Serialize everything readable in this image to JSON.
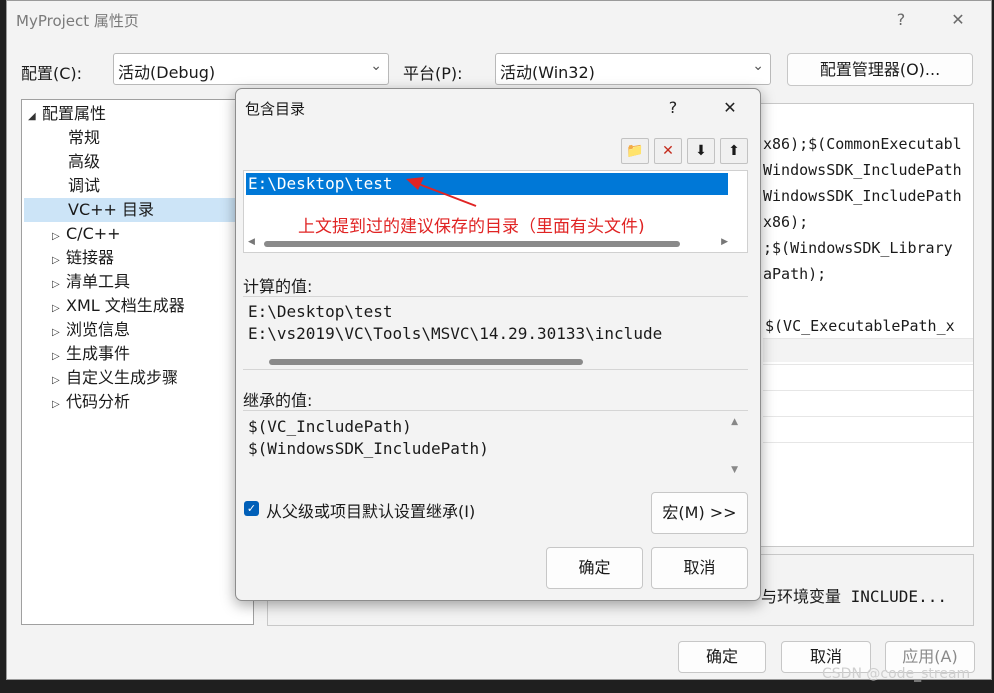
{
  "window": {
    "title": "MyProject 属性页",
    "help": "?",
    "close": "✕"
  },
  "config": {
    "config_label": "配置(C):",
    "config_value": "活动(Debug)",
    "platform_label": "平台(P):",
    "platform_value": "活动(Win32)",
    "manager_button": "配置管理器(O)..."
  },
  "tree": {
    "root": "配置属性",
    "items": [
      "常规",
      "高级",
      "调试",
      "VC++ 目录",
      "C/C++",
      "链接器",
      "清单工具",
      "XML 文档生成器",
      "浏览信息",
      "生成事件",
      "自定义生成步骤",
      "代码分析"
    ],
    "selected": "VC++ 目录"
  },
  "grid": {
    "lines": [
      "x86);$(CommonExecutabl",
      "WindowsSDK_IncludePath",
      "WindowsSDK_IncludePath",
      "x86);",
      ";$(WindowsSDK_Library",
      "aPath);",
      "",
      "$(VC_ExecutablePath_x"
    ],
    "description": "与环境变量 INCLUDE..."
  },
  "footer": {
    "ok": "确定",
    "cancel": "取消",
    "apply": "应用(A)"
  },
  "dialog": {
    "title": "包含目录",
    "help": "?",
    "close": "✕",
    "list_items": [
      "E:\\Desktop\\test"
    ],
    "annotation": "上文提到过的建议保存的目录（里面有头文件)",
    "computed_label": "计算的值:",
    "computed_values": [
      "E:\\Desktop\\test",
      "E:\\vs2019\\VC\\Tools\\MSVC\\14.29.30133\\include"
    ],
    "inherited_label": "继承的值:",
    "inherited_values": [
      "$(VC_IncludePath)",
      "$(WindowsSDK_IncludePath)"
    ],
    "inherit_checkbox": "从父级或项目默认设置继承(I)",
    "macro_button": "宏(M) >>",
    "ok": "确定",
    "cancel": "取消"
  },
  "watermark": "CSDN @code_stream",
  "colors": {
    "selection": "#0078d7",
    "annotation": "#e02424",
    "tree_selected": "#cce4f7"
  }
}
